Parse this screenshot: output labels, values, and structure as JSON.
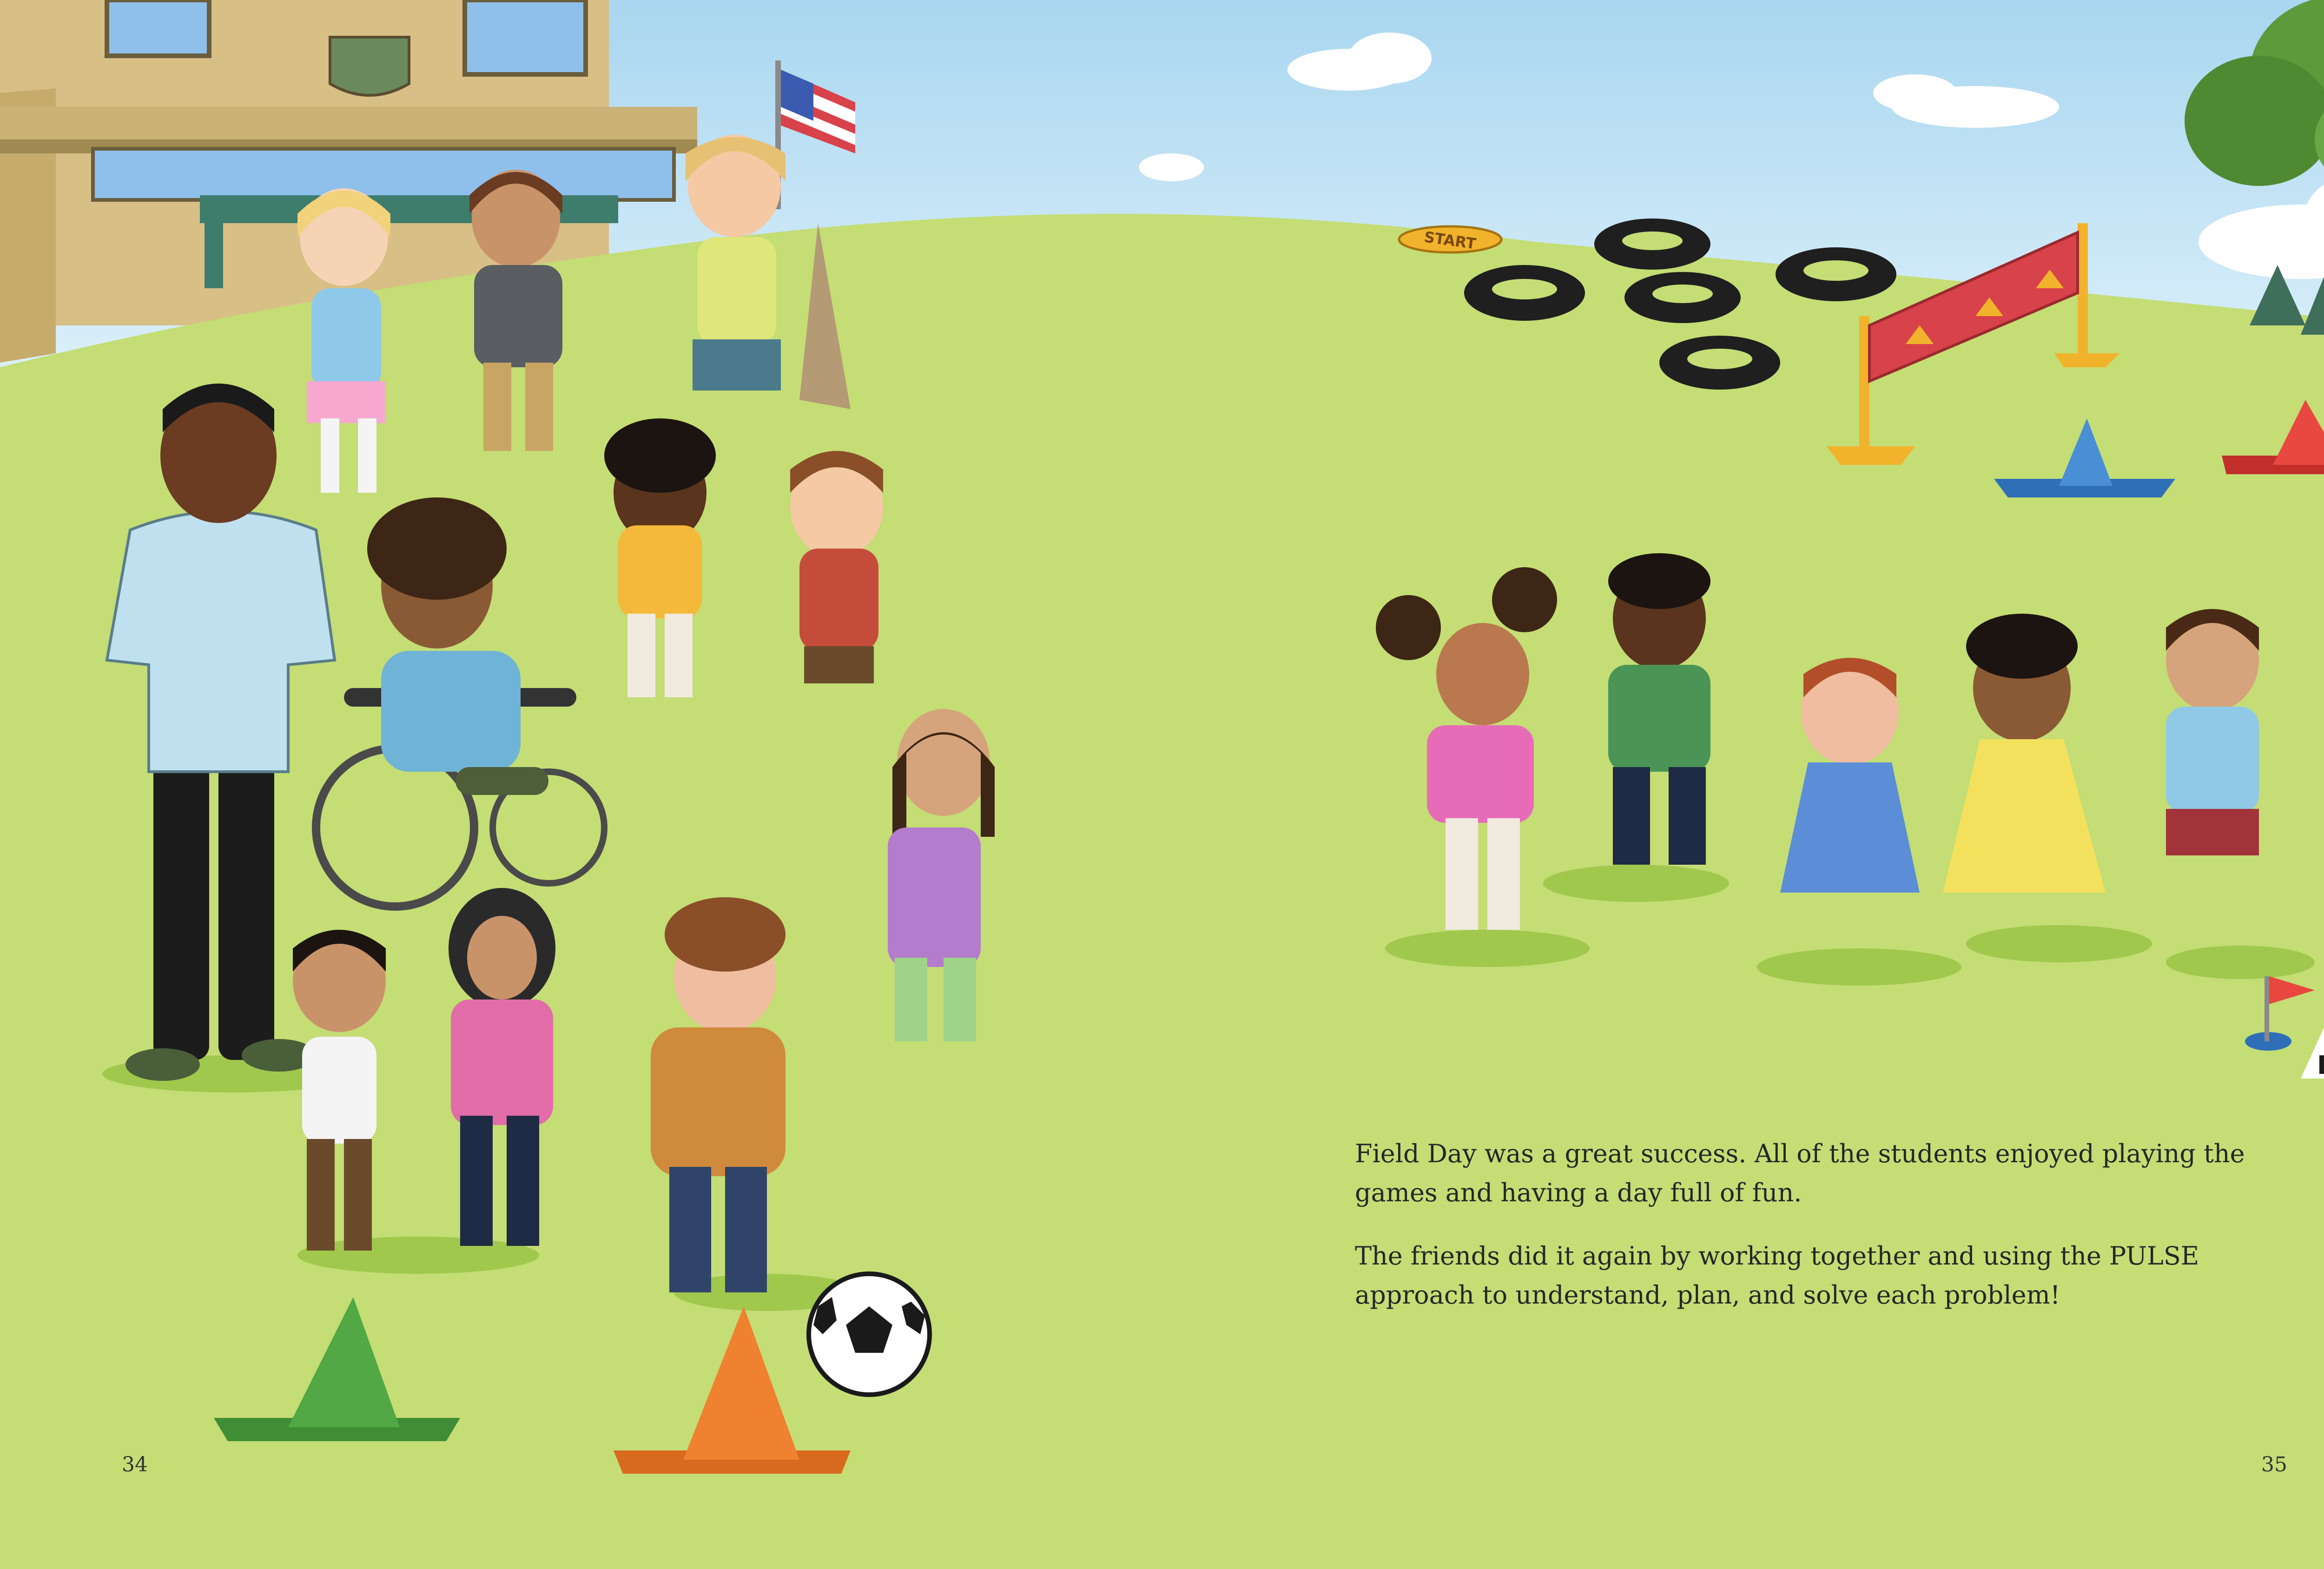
{
  "spread": {
    "paragraphs": [
      "Field Day was a great success. All of the students enjoyed playing the games and having a day full of fun.",
      "The friends did it again by working together and using the PULSE approach to understand, plan, and solve each problem!"
    ],
    "page_left_number": "34",
    "page_right_number": "35"
  },
  "scene": {
    "start_sign_text": "START",
    "colors": {
      "sky": "#bfe3f5",
      "grass": "#c4dd75",
      "grass_dark": "#9fc84d",
      "building": "#d7bf86",
      "banner": "#d8424a",
      "cone_green": "#52a844",
      "cone_orange": "#f08131",
      "cone_blue": "#4a8fd6",
      "cone_red": "#e8483f"
    },
    "icons": [
      "school-building",
      "us-flag",
      "tree",
      "tire-obstacles",
      "start-sign",
      "banner-hurdle",
      "traffic-cone",
      "soccer-ball",
      "finish-flag",
      "checkered-mat",
      "child-figures",
      "teacher-figure",
      "wheelchair"
    ]
  }
}
